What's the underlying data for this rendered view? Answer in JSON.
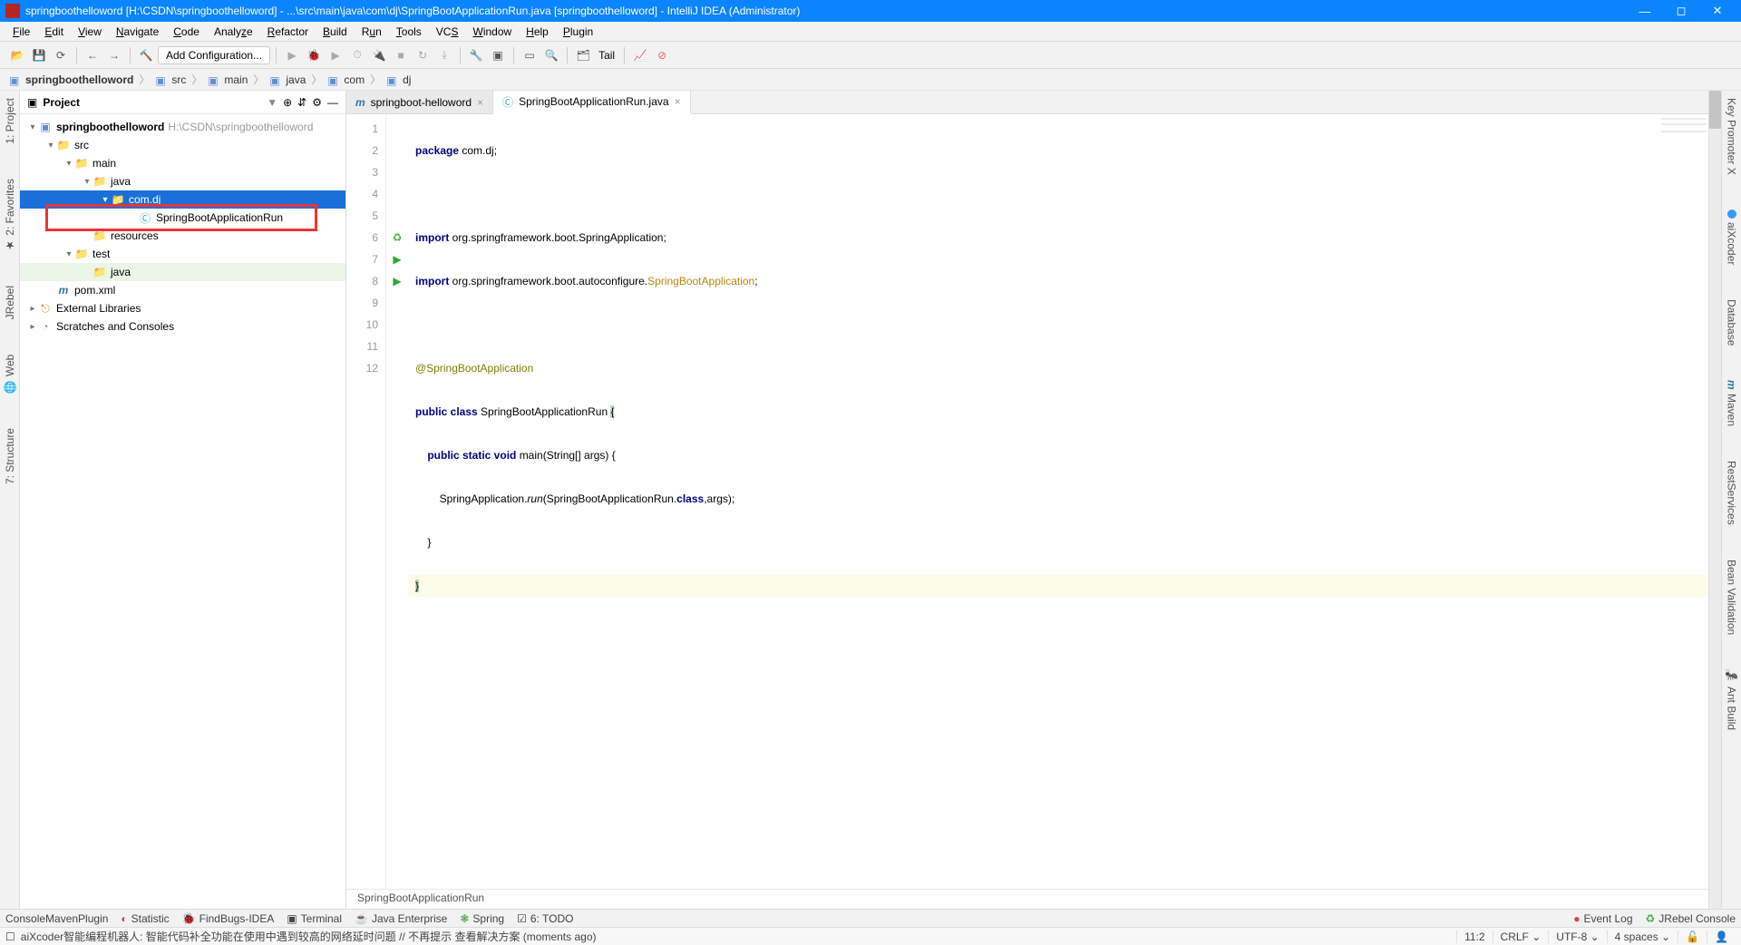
{
  "window": {
    "title": "springboothelloword [H:\\CSDN\\springboothelloword] - ...\\src\\main\\java\\com\\dj\\SpringBootApplicationRun.java [springboothelloword] - IntelliJ IDEA (Administrator)"
  },
  "menu": [
    "File",
    "Edit",
    "View",
    "Navigate",
    "Code",
    "Analyze",
    "Refactor",
    "Build",
    "Run",
    "Tools",
    "VCS",
    "Window",
    "Help",
    "Plugin"
  ],
  "toolbar": {
    "addConfig": "Add Configuration...",
    "tail": "Tail"
  },
  "breadcrumb": [
    "springboothelloword",
    "src",
    "main",
    "java",
    "com",
    "dj"
  ],
  "project": {
    "header": "Project",
    "root": "springboothelloword",
    "rootPath": "H:\\CSDN\\springboothelloword",
    "nodes": {
      "src": "src",
      "main": "main",
      "java": "java",
      "pkg": "com.dj",
      "file": "SpringBootApplicationRun",
      "res": "resources",
      "test": "test",
      "testjava": "java",
      "pom": "pom.xml",
      "ext": "External Libraries",
      "scr": "Scratches and Consoles"
    }
  },
  "leftTabs": [
    "1: Project",
    "2: Favorites",
    "JRebel",
    "Web",
    "7: Structure"
  ],
  "rightTabs": [
    "Key Promoter X",
    "aiXcoder",
    "Database",
    "Maven",
    "RestServices",
    "Bean Validation",
    "Ant Build"
  ],
  "editor": {
    "tabs": [
      {
        "label": "springboot-helloword",
        "icon": "m",
        "active": false
      },
      {
        "label": "SpringBootApplicationRun.java",
        "icon": "c",
        "active": true
      }
    ],
    "lines": [
      "1",
      "2",
      "3",
      "4",
      "5",
      "6",
      "7",
      "8",
      "9",
      "10",
      "11",
      "12"
    ],
    "code": {
      "l1a": "package",
      "l1b": " com.dj;",
      "l3a": "import",
      "l3b": " org.springframework.boot.SpringApplication;",
      "l4a": "import",
      "l4b": " org.springframework.boot.autoconfigure.",
      "l4c": "SpringBootApplication",
      "l4d": ";",
      "l6": "@SpringBootApplication",
      "l7a": "public class ",
      "l7b": "SpringBootApplicationRun ",
      "l7c": "{",
      "l8a": "    public static void ",
      "l8b": "main",
      "l8c": "(String[] args) {",
      "l9a": "        SpringApplication.",
      "l9b": "run",
      "l9c": "(SpringBootApplicationRun.",
      "l9d": "class",
      "l9e": ",args);",
      "l10": "    }",
      "l11": "}"
    },
    "context": "SpringBootApplicationRun"
  },
  "bottom": [
    "ConsoleMavenPlugin",
    "Statistic",
    "FindBugs-IDEA",
    "Terminal",
    "Java Enterprise",
    "Spring",
    "6: TODO"
  ],
  "bottomRight": [
    "Event Log",
    "JRebel Console"
  ],
  "status": {
    "msg": "aiXcoder智能编程机器人: 智能代码补全功能在使用中遇到较高的网络延时问题 // 不再提示 查看解决方案 (moments ago)",
    "pos": "11:2",
    "eol": "CRLF",
    "enc": "UTF-8",
    "indent": "4 spaces"
  }
}
